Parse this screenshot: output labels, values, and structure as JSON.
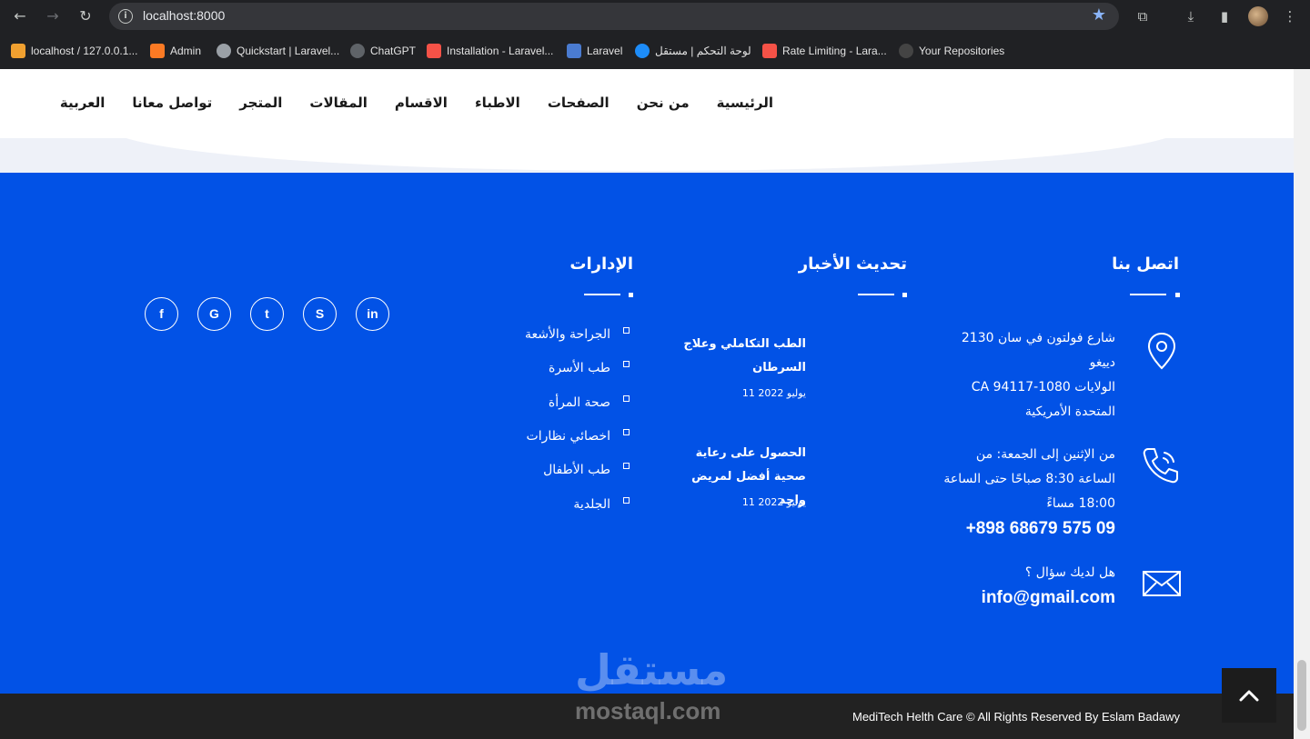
{
  "browser": {
    "url": "localhost:8000",
    "bookmarks": [
      {
        "label": "localhost / 127.0.0.1...",
        "color": "#f0a030"
      },
      {
        "label": "Admin",
        "color": "#fb7a24"
      },
      {
        "label": "Quickstart | Laravel...",
        "color": "#9aa0a6"
      },
      {
        "label": "ChatGPT",
        "color": "#5f6368"
      },
      {
        "label": "Installation - Laravel...",
        "color": "#f55247"
      },
      {
        "label": "Laravel",
        "color": "#4a7bd0"
      },
      {
        "label": "لوحة التحكم | مستقل",
        "color": "#1d8cf8"
      },
      {
        "label": "Rate Limiting - Lara...",
        "color": "#f55247"
      },
      {
        "label": "Your Repositories",
        "color": "#444444"
      }
    ]
  },
  "nav": {
    "items": [
      "الرئيسية",
      "من نحن",
      "الصفحات",
      "الاطباء",
      "الاقسام",
      "المقالات",
      "المتجر",
      "تواصل معانا",
      "العربية"
    ]
  },
  "footer": {
    "contact": {
      "title": "اتصل بنا",
      "address_line1": "شارع فولتون في سان 2130",
      "address_line2": "دييغو",
      "address_line3": "الولايات CA 94117-1080",
      "address_line4": "المتحدة الأمريكية",
      "hours_line1": "من الإثنين إلى الجمعة: من",
      "hours_line2": "الساعة 8:30 صباحًا حتى الساعة",
      "hours_line3": "18:00 مساءً",
      "phone": "+898 68679 575 09",
      "question": "هل لديك سؤال ؟",
      "email": "info@gmail.com"
    },
    "news": {
      "title": "تحديث الأخبار",
      "items": [
        {
          "title": "الطب التكاملي وعلاج السرطان",
          "date": "يوليو 2022 11"
        },
        {
          "title": "الحصول على رعاية صحية أفضل لمريض واحد",
          "date": "يوليو 2022 11"
        }
      ]
    },
    "departments": {
      "title": "الإدارات",
      "items": [
        "الجراحة والأشعة",
        "طب الأسرة",
        "صحة المرأة",
        "اخصائي نظارات",
        "طب الأطفال",
        "الجلدية"
      ]
    },
    "social": [
      {
        "name": "linkedin",
        "glyph": "in"
      },
      {
        "name": "skype",
        "glyph": "S"
      },
      {
        "name": "twitter",
        "glyph": "t"
      },
      {
        "name": "google",
        "glyph": "G"
      },
      {
        "name": "facebook",
        "glyph": "f"
      }
    ],
    "copyright": "MediTech Helth Care © All Rights Reserved By Eslam Badawy",
    "watermark_ar": "مستقل",
    "watermark_en": "mostaql.com"
  },
  "colors": {
    "footer_bg": "#0252e6",
    "bottom_bar": "#222222",
    "browser_chrome": "#202124"
  }
}
